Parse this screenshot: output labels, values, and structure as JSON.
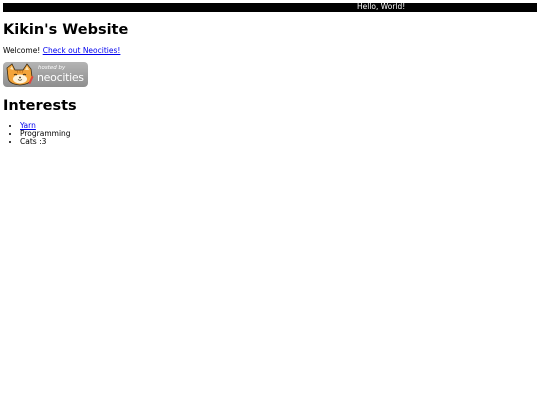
{
  "marquee": {
    "text": "Hello, World!"
  },
  "page": {
    "title": "Kikin's Website",
    "welcome_prefix": "Welcome! ",
    "welcome_link": "Check out Neocities!"
  },
  "badge": {
    "hosted_by": "hosted by",
    "brand": "neocities"
  },
  "interests": {
    "heading": "Interests",
    "items": [
      {
        "label": "Yarn",
        "is_link": true
      },
      {
        "label": "Programming",
        "is_link": false
      },
      {
        "label": "Cats :3",
        "is_link": false
      }
    ]
  },
  "colors": {
    "link": "#0000ee",
    "marquee_bg": "#000000",
    "marquee_text": "#ffffff",
    "badge_bg": "#9e9e9e",
    "cat_orange": "#f3a43a"
  },
  "icons": [
    "neocities-cat-icon"
  ]
}
